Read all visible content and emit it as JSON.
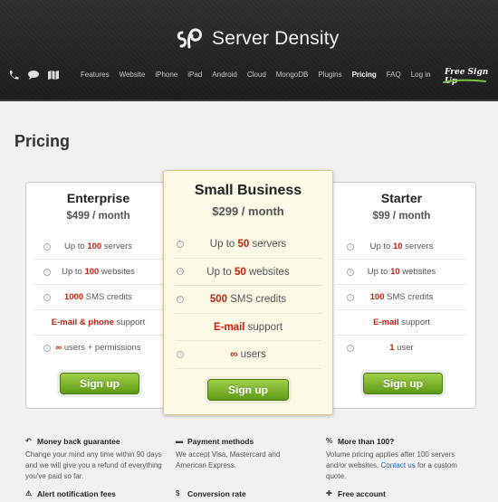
{
  "header": {
    "logo_text": "Server Density",
    "nav": [
      {
        "label": "Features",
        "active": false
      },
      {
        "label": "Website",
        "active": false
      },
      {
        "label": "iPhone",
        "active": false
      },
      {
        "label": "iPad",
        "active": false
      },
      {
        "label": "Android",
        "active": false
      },
      {
        "label": "Cloud",
        "active": false
      },
      {
        "label": "MongoDB",
        "active": false
      },
      {
        "label": "Plugins",
        "active": false
      },
      {
        "label": "Pricing",
        "active": true
      },
      {
        "label": "FAQ",
        "active": false
      },
      {
        "label": "Log in",
        "active": false
      }
    ],
    "signup_label": "Free Sign Up",
    "icons": [
      "phone-icon",
      "chat-icon",
      "map-icon"
    ]
  },
  "page_title": "Pricing",
  "plans": {
    "enterprise": {
      "name": "Enterprise",
      "price": "$499 / month",
      "features": [
        {
          "pre": "Up to ",
          "hl": "100",
          "post": " servers"
        },
        {
          "pre": "Up to ",
          "hl": "100",
          "post": " websites"
        },
        {
          "pre": "",
          "hl": "1000",
          "post": " SMS credits"
        },
        {
          "pre": "",
          "hl": "E-mail & phone",
          "post": " support"
        },
        {
          "pre": "",
          "hl": "∞",
          "post": " users + permissions"
        }
      ],
      "button": "Sign up"
    },
    "small_business": {
      "name": "Small Business",
      "price": "$299 / month",
      "features": [
        {
          "pre": "Up to ",
          "hl": "50",
          "post": " servers"
        },
        {
          "pre": "Up to ",
          "hl": "50",
          "post": " websites"
        },
        {
          "pre": "",
          "hl": "500",
          "post": " SMS credits"
        },
        {
          "pre": "",
          "hl": "E-mail",
          "post": " support"
        },
        {
          "pre": "",
          "hl": "∞",
          "post": " users"
        }
      ],
      "button": "Sign up"
    },
    "starter": {
      "name": "Starter",
      "price": "$99 / month",
      "features": [
        {
          "pre": "Up to ",
          "hl": "10",
          "post": " servers"
        },
        {
          "pre": "Up to ",
          "hl": "10",
          "post": " websites"
        },
        {
          "pre": "",
          "hl": "100",
          "post": " SMS credits"
        },
        {
          "pre": "",
          "hl": "E-mail",
          "post": " support"
        },
        {
          "pre": "",
          "hl": "1",
          "post": " user"
        }
      ],
      "button": "Sign up"
    }
  },
  "info": {
    "money_back": {
      "title": "Money back guarantee",
      "text": "Change your mind any time within 90 days and we will give you a refund of everything you've paid so far."
    },
    "payment": {
      "title": "Payment methods",
      "text": "We accept Visa, Mastercard and American Express."
    },
    "more": {
      "title": "More than 100?",
      "text_before": "Volume pricing applies after 100 servers and/or websites. ",
      "link": "Contact us",
      "text_after": " for a custom quote."
    },
    "alert_fees": {
      "title": "Alert notification fees"
    },
    "conversion": {
      "title": "Conversion rate"
    },
    "free_account": {
      "title": "Free account"
    }
  },
  "colors": {
    "highlight": "#c8200d",
    "button_green": "#6fae1f",
    "header_bg": "#262626",
    "featured_bg": "#fcf9e7"
  }
}
